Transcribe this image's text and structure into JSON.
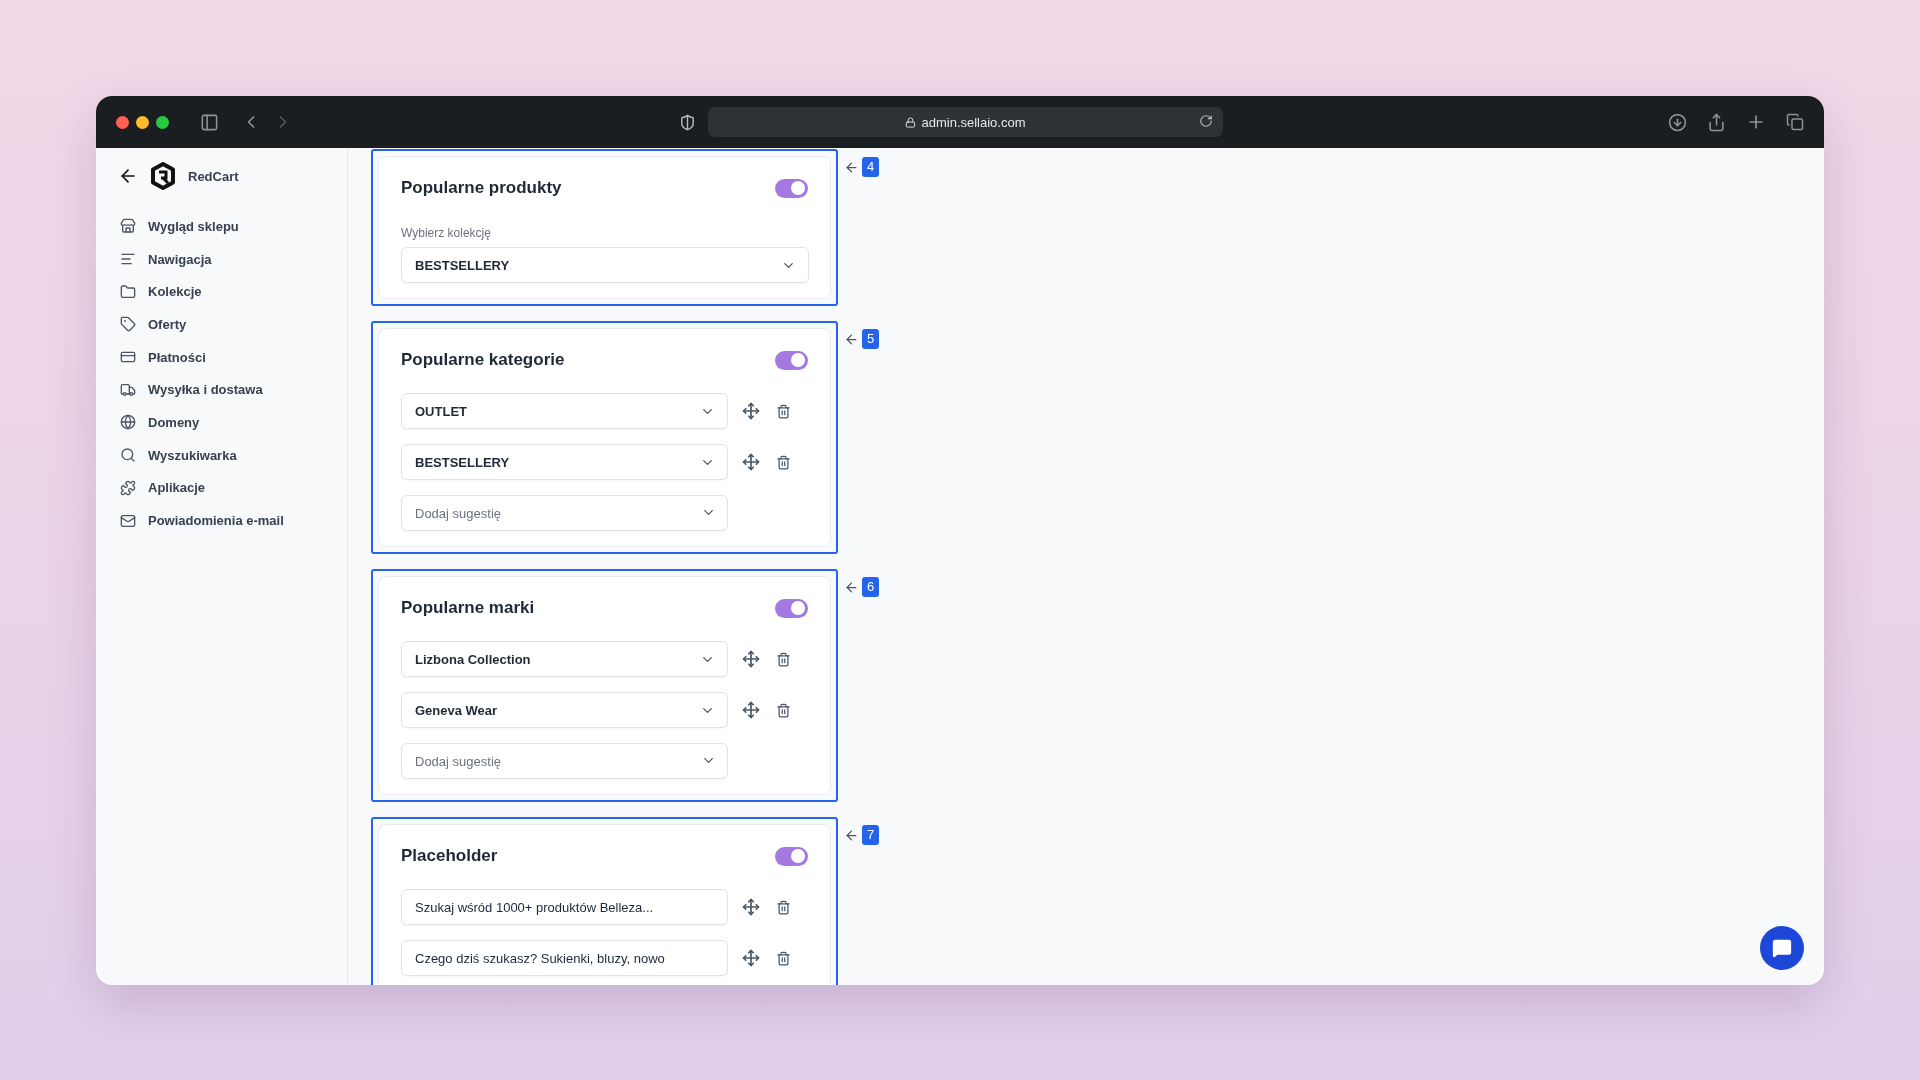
{
  "browser": {
    "url": "admin.sellaio.com"
  },
  "sidebar": {
    "brand": "RedCart",
    "items": [
      {
        "label": "Wygląd sklepu"
      },
      {
        "label": "Nawigacja"
      },
      {
        "label": "Kolekcje"
      },
      {
        "label": "Oferty"
      },
      {
        "label": "Płatności"
      },
      {
        "label": "Wysyłka i dostawa"
      },
      {
        "label": "Domeny"
      },
      {
        "label": "Wyszukiwarka"
      },
      {
        "label": "Aplikacje"
      },
      {
        "label": "Powiadomienia e-mail"
      }
    ]
  },
  "sections": [
    {
      "badge": "4",
      "title": "Popularne produkty",
      "on": true,
      "kind": "collection",
      "label": "Wybierz kolekcję",
      "value": "BESTSELLERY"
    },
    {
      "badge": "5",
      "title": "Popularne kategorie",
      "on": true,
      "kind": "suggestions",
      "items": [
        "OUTLET",
        "BESTSELLERY"
      ],
      "placeholder": "Dodaj sugestię"
    },
    {
      "badge": "6",
      "title": "Popularne marki",
      "on": true,
      "kind": "suggestions",
      "items": [
        "Lizbona Collection",
        "Geneva Wear"
      ],
      "placeholder": "Dodaj sugestię"
    },
    {
      "badge": "7",
      "title": "Placeholder",
      "on": true,
      "kind": "texts",
      "items": [
        "Szukaj wśród 1000+ produktów Belleza...",
        "Czego dziś szukasz? Sukienki, bluzy, nowo"
      ]
    }
  ]
}
